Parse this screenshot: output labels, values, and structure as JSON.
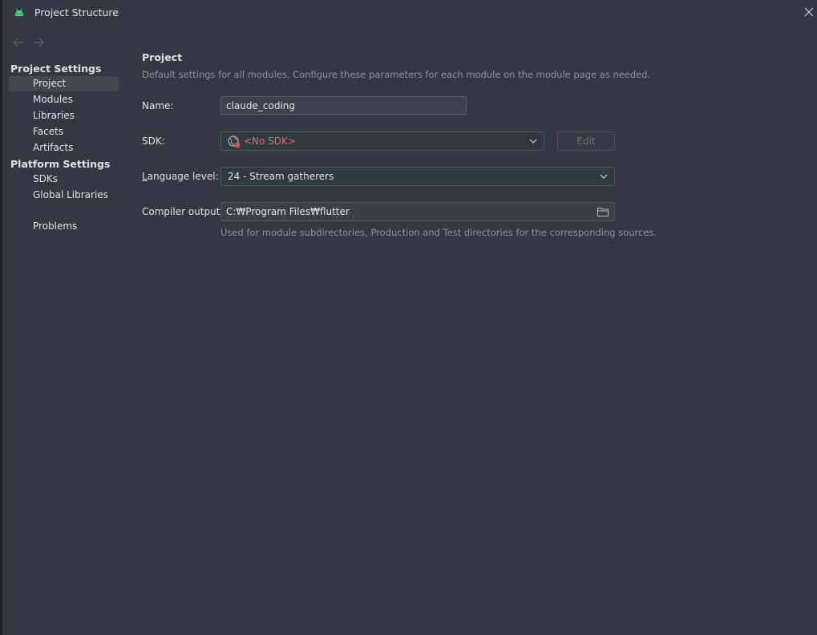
{
  "window": {
    "title": "Project Structure"
  },
  "sidebar": {
    "project_settings_header": "Project Settings",
    "project_settings_items": [
      {
        "label": "Project",
        "selected": true
      },
      {
        "label": "Modules"
      },
      {
        "label": "Libraries"
      },
      {
        "label": "Facets"
      },
      {
        "label": "Artifacts"
      }
    ],
    "platform_settings_header": "Platform Settings",
    "platform_settings_items": [
      {
        "label": "SDKs"
      },
      {
        "label": "Global Libraries"
      }
    ],
    "problems_label": "Problems"
  },
  "main": {
    "title": "Project",
    "description": "Default settings for all modules. Configure these parameters for each module on the module page as needed.",
    "name_label": "Name:",
    "name_value": "claude_coding",
    "sdk_label": "SDK:",
    "sdk_value": "<No SDK>",
    "edit_button": "Edit",
    "language_label_mnemonic": "L",
    "language_label_rest": "anguage level:",
    "language_value": "24 - Stream gatherers",
    "compiler_label": "Compiler output:",
    "compiler_value": "C:₩Program Files₩flutter",
    "compiler_hint": "Used for module subdirectories, Production and Test directories for the corresponding sources."
  },
  "colors": {
    "background": "#333842",
    "selection": "#43474f",
    "error_text": "#e06c75",
    "android_green": "#3ddc84"
  },
  "icons": {
    "app": "android-icon",
    "close": "close-icon",
    "back": "arrow-left-icon",
    "forward": "arrow-right-icon",
    "sdk": "sdk-globe-icon",
    "dropdown": "chevron-down-icon",
    "folder": "folder-icon"
  }
}
